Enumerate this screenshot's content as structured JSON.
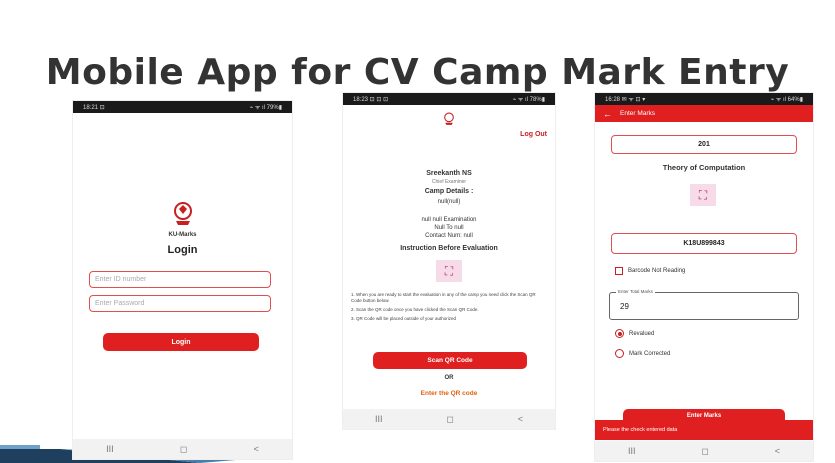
{
  "title": "Mobile App for CV Camp Mark Entry",
  "phone1": {
    "status_time": "18:21 ⊡",
    "status_icons": "⌁ ᯤ ıl 79%▮",
    "logo_text": "KU-Marks",
    "heading": "Login",
    "id_placeholder": "Enter ID number",
    "password_placeholder": "Enter Password",
    "login_button": "Login",
    "nav": [
      "III",
      "◻",
      "<"
    ]
  },
  "phone2": {
    "status_time": "18:23 ⊡ ⊡ ⊡",
    "status_icons": "⌁ ᯤ ıl 78%▮",
    "logout": "Log Out",
    "examiner_name": "Sreekanth NS",
    "examiner_role": "Chief Examiner",
    "camp_details_heading": "Camp Details :",
    "camp_details_value": "null(null)",
    "exam_line1": "null null Examination",
    "exam_line2": "Null To null",
    "exam_line3": "Contact Num: null",
    "instructions_heading": "Instruction Before Evaluation",
    "instructions": [
      "1. When you are ready to start the evaluation in any of the camp you need click the Scan QR Code button below.",
      "2. Scan the QR code once you have clicked the Scan QR Code.",
      "3. QR Code will be placed outside of your authorized"
    ],
    "scan_button": "Scan QR Code",
    "or_text": "OR",
    "enter_qr_link": "Enter the QR code",
    "nav": [
      "III",
      "◻",
      "<"
    ]
  },
  "phone3": {
    "status_time": "16:28 ✉ ᯤ ⊡ ▾",
    "status_icons": "⌁ ᯤ ıl 64%▮",
    "header_title": "Enter Marks",
    "code": "201",
    "subject": "Theory of Computation",
    "register_number": "K18U899843",
    "barcode_label": "Barcode Not Reading",
    "total_marks_label": "Enter Total Marks",
    "total_marks_value": "29",
    "radio_revalued": "Revalued",
    "radio_mark_corrected": "Mark Corrected",
    "submit_button": "Enter Marks",
    "toast": "Please the check entered data",
    "nav": [
      "III",
      "◻",
      "<"
    ]
  },
  "colors": {
    "accent": "#e02020",
    "link": "#e06010"
  }
}
